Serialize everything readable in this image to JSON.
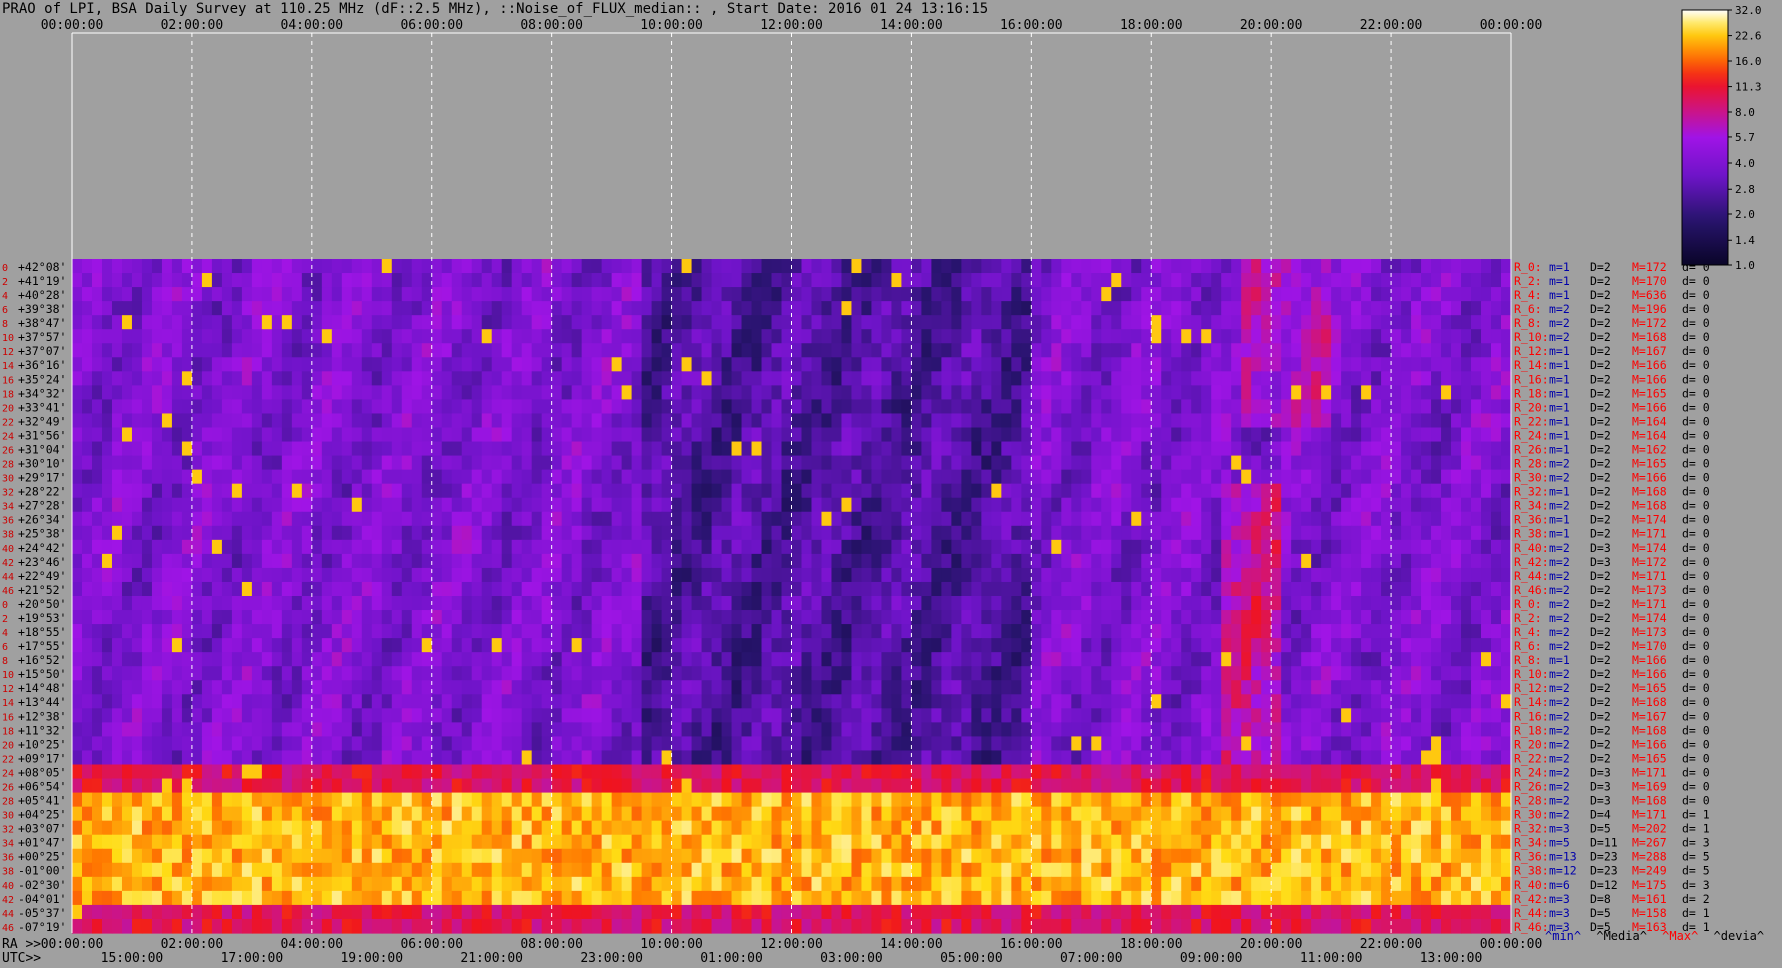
{
  "title": "PRAO of LPI, BSA Daily Survey at 110.25 MHz (dF::2.5 MHz), ::Noise_of_FLUX_median:: , Start Date: 2016 01 24 13:16:15",
  "colors": {
    "background": "#a0a0a0",
    "tick_text": "#000000",
    "row_index_text": "#cc0000",
    "stat_red": "#ff0000",
    "stat_blue": "#0000aa"
  },
  "chart_data": {
    "type": "heatmap",
    "title": "PRAO of LPI, BSA Daily Survey at 110.25 MHz (dF::2.5 MHz), ::Noise_of_FLUX_median:: , Start Date: 2016 01 24 13:16:15",
    "x_top_ticks": [
      "00:00:00",
      "02:00:00",
      "04:00:00",
      "06:00:00",
      "08:00:00",
      "10:00:00",
      "12:00:00",
      "14:00:00",
      "16:00:00",
      "18:00:00",
      "20:00:00",
      "22:00:00",
      "00:00:00"
    ],
    "x_bottom_prefix": "RA >>",
    "x_bottom_ticks": [
      "00:00:00",
      "02:00:00",
      "04:00:00",
      "06:00:00",
      "08:00:00",
      "10:00:00",
      "12:00:00",
      "14:00:00",
      "16:00:00",
      "18:00:00",
      "20:00:00",
      "22:00:00",
      "00:00:00"
    ],
    "utc_prefix": "UTC>>",
    "utc_ticks": [
      "15:00:00",
      "17:00:00",
      "19:00:00",
      "21:00:00",
      "23:00:00",
      "01:00:00",
      "03:00:00",
      "05:00:00",
      "07:00:00",
      "09:00:00",
      "11:00:00",
      "13:00:00"
    ],
    "row_indices": [
      "0",
      "2",
      "4",
      "6",
      "8",
      "10",
      "12",
      "14",
      "16",
      "18",
      "20",
      "22",
      "24",
      "26",
      "28",
      "30",
      "32",
      "34",
      "36",
      "38",
      "40",
      "42",
      "44",
      "46",
      "0",
      "2",
      "4",
      "6",
      "8",
      "10",
      "12",
      "14",
      "16",
      "18",
      "20",
      "22",
      "24",
      "26",
      "28",
      "30",
      "32",
      "34",
      "36",
      "38",
      "40",
      "42",
      "44",
      "46"
    ],
    "declinations": [
      "+42°08'",
      "+41°19'",
      "+40°28'",
      "+39°38'",
      "+38°47'",
      "+37°57'",
      "+37°07'",
      "+36°16'",
      "+35°24'",
      "+34°32'",
      "+33°41'",
      "+32°49'",
      "+31°56'",
      "+31°04'",
      "+30°10'",
      "+29°17'",
      "+28°22'",
      "+27°28'",
      "+26°34'",
      "+25°38'",
      "+24°42'",
      "+23°46'",
      "+22°49'",
      "+21°52'",
      "+20°50'",
      "+19°53'",
      "+18°55'",
      "+17°55'",
      "+16°52'",
      "+15°50'",
      "+14°48'",
      "+13°44'",
      "+12°38'",
      "+11°32'",
      "+10°25'",
      "+09°17'",
      "+08°05'",
      "+06°54'",
      "+05°41'",
      "+04°25'",
      "+03°07'",
      "+01°47'",
      "+00°25'",
      "-01°00'",
      "-02°30'",
      "-04°01'",
      "-05°37'",
      "-07°19'"
    ],
    "row_stats": [
      {
        "r": "R_0:",
        "m": "m=1",
        "d": "D=2",
        "M": "M=172",
        "dev": "d= 0"
      },
      {
        "r": "R_2:",
        "m": "m=1",
        "d": "D=2",
        "M": "M=170",
        "dev": "d= 0"
      },
      {
        "r": "R_4:",
        "m": "m=1",
        "d": "D=2",
        "M": "M=636",
        "dev": "d= 0"
      },
      {
        "r": "R_6:",
        "m": "m=2",
        "d": "D=2",
        "M": "M=196",
        "dev": "d= 0"
      },
      {
        "r": "R_8:",
        "m": "m=2",
        "d": "D=2",
        "M": "M=172",
        "dev": "d= 0"
      },
      {
        "r": "R_10:",
        "m": "m=2",
        "d": "D=2",
        "M": "M=168",
        "dev": "d= 0"
      },
      {
        "r": "R_12:",
        "m": "m=1",
        "d": "D=2",
        "M": "M=167",
        "dev": "d= 0"
      },
      {
        "r": "R_14:",
        "m": "m=1",
        "d": "D=2",
        "M": "M=166",
        "dev": "d= 0"
      },
      {
        "r": "R_16:",
        "m": "m=1",
        "d": "D=2",
        "M": "M=166",
        "dev": "d= 0"
      },
      {
        "r": "R_18:",
        "m": "m=1",
        "d": "D=2",
        "M": "M=165",
        "dev": "d= 0"
      },
      {
        "r": "R_20:",
        "m": "m=1",
        "d": "D=2",
        "M": "M=166",
        "dev": "d= 0"
      },
      {
        "r": "R_22:",
        "m": "m=1",
        "d": "D=2",
        "M": "M=164",
        "dev": "d= 0"
      },
      {
        "r": "R_24:",
        "m": "m=1",
        "d": "D=2",
        "M": "M=164",
        "dev": "d= 0"
      },
      {
        "r": "R_26:",
        "m": "m=1",
        "d": "D=2",
        "M": "M=162",
        "dev": "d= 0"
      },
      {
        "r": "R_28:",
        "m": "m=2",
        "d": "D=2",
        "M": "M=165",
        "dev": "d= 0"
      },
      {
        "r": "R_30:",
        "m": "m=2",
        "d": "D=2",
        "M": "M=166",
        "dev": "d= 0"
      },
      {
        "r": "R_32:",
        "m": "m=1",
        "d": "D=2",
        "M": "M=168",
        "dev": "d= 0"
      },
      {
        "r": "R_34:",
        "m": "m=2",
        "d": "D=2",
        "M": "M=168",
        "dev": "d= 0"
      },
      {
        "r": "R_36:",
        "m": "m=1",
        "d": "D=2",
        "M": "M=174",
        "dev": "d= 0"
      },
      {
        "r": "R_38:",
        "m": "m=1",
        "d": "D=2",
        "M": "M=171",
        "dev": "d= 0"
      },
      {
        "r": "R_40:",
        "m": "m=2",
        "d": "D=3",
        "M": "M=174",
        "dev": "d= 0"
      },
      {
        "r": "R_42:",
        "m": "m=2",
        "d": "D=3",
        "M": "M=172",
        "dev": "d= 0"
      },
      {
        "r": "R_44:",
        "m": "m=2",
        "d": "D=2",
        "M": "M=171",
        "dev": "d= 0"
      },
      {
        "r": "R_46:",
        "m": "m=2",
        "d": "D=2",
        "M": "M=173",
        "dev": "d= 0"
      },
      {
        "r": "R_0:",
        "m": "m=2",
        "d": "D=2",
        "M": "M=171",
        "dev": "d= 0"
      },
      {
        "r": "R_2:",
        "m": "m=2",
        "d": "D=2",
        "M": "M=174",
        "dev": "d= 0"
      },
      {
        "r": "R_4:",
        "m": "m=2",
        "d": "D=2",
        "M": "M=173",
        "dev": "d= 0"
      },
      {
        "r": "R_6:",
        "m": "m=2",
        "d": "D=2",
        "M": "M=170",
        "dev": "d= 0"
      },
      {
        "r": "R_8:",
        "m": "m=1",
        "d": "D=2",
        "M": "M=166",
        "dev": "d= 0"
      },
      {
        "r": "R_10:",
        "m": "m=2",
        "d": "D=2",
        "M": "M=166",
        "dev": "d= 0"
      },
      {
        "r": "R_12:",
        "m": "m=2",
        "d": "D=2",
        "M": "M=165",
        "dev": "d= 0"
      },
      {
        "r": "R_14:",
        "m": "m=2",
        "d": "D=2",
        "M": "M=168",
        "dev": "d= 0"
      },
      {
        "r": "R_16:",
        "m": "m=2",
        "d": "D=2",
        "M": "M=167",
        "dev": "d= 0"
      },
      {
        "r": "R_18:",
        "m": "m=2",
        "d": "D=2",
        "M": "M=168",
        "dev": "d= 0"
      },
      {
        "r": "R_20:",
        "m": "m=2",
        "d": "D=2",
        "M": "M=166",
        "dev": "d= 0"
      },
      {
        "r": "R_22:",
        "m": "m=2",
        "d": "D=2",
        "M": "M=165",
        "dev": "d= 0"
      },
      {
        "r": "R_24:",
        "m": "m=2",
        "d": "D=3",
        "M": "M=171",
        "dev": "d= 0"
      },
      {
        "r": "R_26:",
        "m": "m=2",
        "d": "D=3",
        "M": "M=169",
        "dev": "d= 0"
      },
      {
        "r": "R_28:",
        "m": "m=2",
        "d": "D=3",
        "M": "M=168",
        "dev": "d= 0"
      },
      {
        "r": "R_30:",
        "m": "m=2",
        "d": "D=4",
        "M": "M=171",
        "dev": "d= 1"
      },
      {
        "r": "R_32:",
        "m": "m=3",
        "d": "D=5",
        "M": "M=202",
        "dev": "d= 1"
      },
      {
        "r": "R_34:",
        "m": "m=5",
        "d": "D=11",
        "M": "M=267",
        "dev": "d= 3"
      },
      {
        "r": "R_36:",
        "m": "m=13",
        "d": "D=23",
        "M": "M=288",
        "dev": "d= 5"
      },
      {
        "r": "R_38:",
        "m": "m=12",
        "d": "D=23",
        "M": "M=249",
        "dev": "d= 5"
      },
      {
        "r": "R_40:",
        "m": "m=6",
        "d": "D=12",
        "M": "M=175",
        "dev": "d= 3"
      },
      {
        "r": "R_42:",
        "m": "m=3",
        "d": "D=8",
        "M": "M=161",
        "dev": "d= 2"
      },
      {
        "r": "R_44:",
        "m": "m=3",
        "d": "D=5",
        "M": "M=158",
        "dev": "d= 1"
      },
      {
        "r": "R_46:",
        "m": "m=3",
        "d": "D=5",
        "M": "M=163",
        "dev": "d= 1"
      }
    ],
    "stats_legend": [
      "^min^",
      "^Media^",
      "^Max^",
      "^devia^"
    ],
    "colorbar_ticks": [
      "32.0",
      "22.6",
      "16.0",
      "11.3",
      "8.0",
      "5.7",
      "4.0",
      "2.8",
      "2.0",
      "1.4",
      "1.0"
    ],
    "colorbar_range": [
      1.0,
      32.0
    ],
    "colorbar_scale": "log",
    "bright_band_rows": [
      38,
      45
    ],
    "warm_band_rows": [
      36,
      47
    ],
    "bright_transient_ra_hours": [
      19.2,
      20.2
    ]
  }
}
